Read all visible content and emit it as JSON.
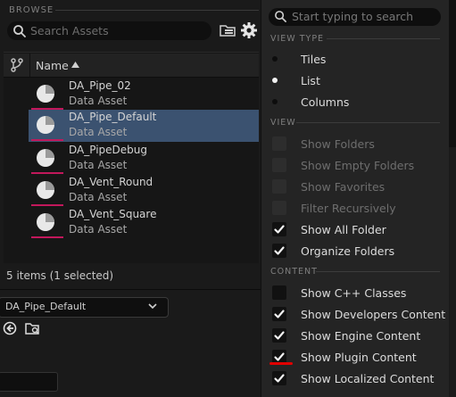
{
  "browse": {
    "section_label": "BROWSE",
    "search_placeholder": "Search Assets",
    "column_name": "Name"
  },
  "assets": [
    {
      "name": "DA_Pipe_02",
      "type": "Data Asset",
      "selected": false
    },
    {
      "name": "DA_Pipe_Default",
      "type": "Data Asset",
      "selected": true
    },
    {
      "name": "DA_PipeDebug",
      "type": "Data Asset",
      "selected": false
    },
    {
      "name": "DA_Vent_Round",
      "type": "Data Asset",
      "selected": false
    },
    {
      "name": "DA_Vent_Square",
      "type": "Data Asset",
      "selected": false
    }
  ],
  "status": "5 items (1 selected)",
  "details": {
    "asset_dropdown": "DA_Pipe_Default"
  },
  "menu": {
    "search_placeholder": "Start typing to search",
    "view_type": {
      "label": "VIEW TYPE",
      "options": [
        {
          "label": "Tiles",
          "selected": false
        },
        {
          "label": "List",
          "selected": true
        },
        {
          "label": "Columns",
          "selected": false
        }
      ]
    },
    "view": {
      "label": "VIEW",
      "items": [
        {
          "label": "Show Folders",
          "checked": false,
          "enabled": false
        },
        {
          "label": "Show Empty Folders",
          "checked": false,
          "enabled": false
        },
        {
          "label": "Show Favorites",
          "checked": false,
          "enabled": false
        },
        {
          "label": "Filter Recursively",
          "checked": false,
          "enabled": false
        },
        {
          "label": "Show All Folder",
          "checked": true,
          "enabled": true
        },
        {
          "label": "Organize Folders",
          "checked": true,
          "enabled": true
        }
      ]
    },
    "content": {
      "label": "CONTENT",
      "items": [
        {
          "label": "Show C++ Classes",
          "checked": false,
          "enabled": true
        },
        {
          "label": "Show Developers Content",
          "checked": true,
          "enabled": true
        },
        {
          "label": "Show Engine Content",
          "checked": true,
          "enabled": true
        },
        {
          "label": "Show Plugin Content",
          "checked": true,
          "enabled": true
        },
        {
          "label": "Show Localized Content",
          "checked": true,
          "enabled": true
        }
      ]
    }
  },
  "colors": {
    "selection": "#3b5270",
    "thumb_underline": "#c2185b",
    "annotation_underline": "#e00000"
  }
}
